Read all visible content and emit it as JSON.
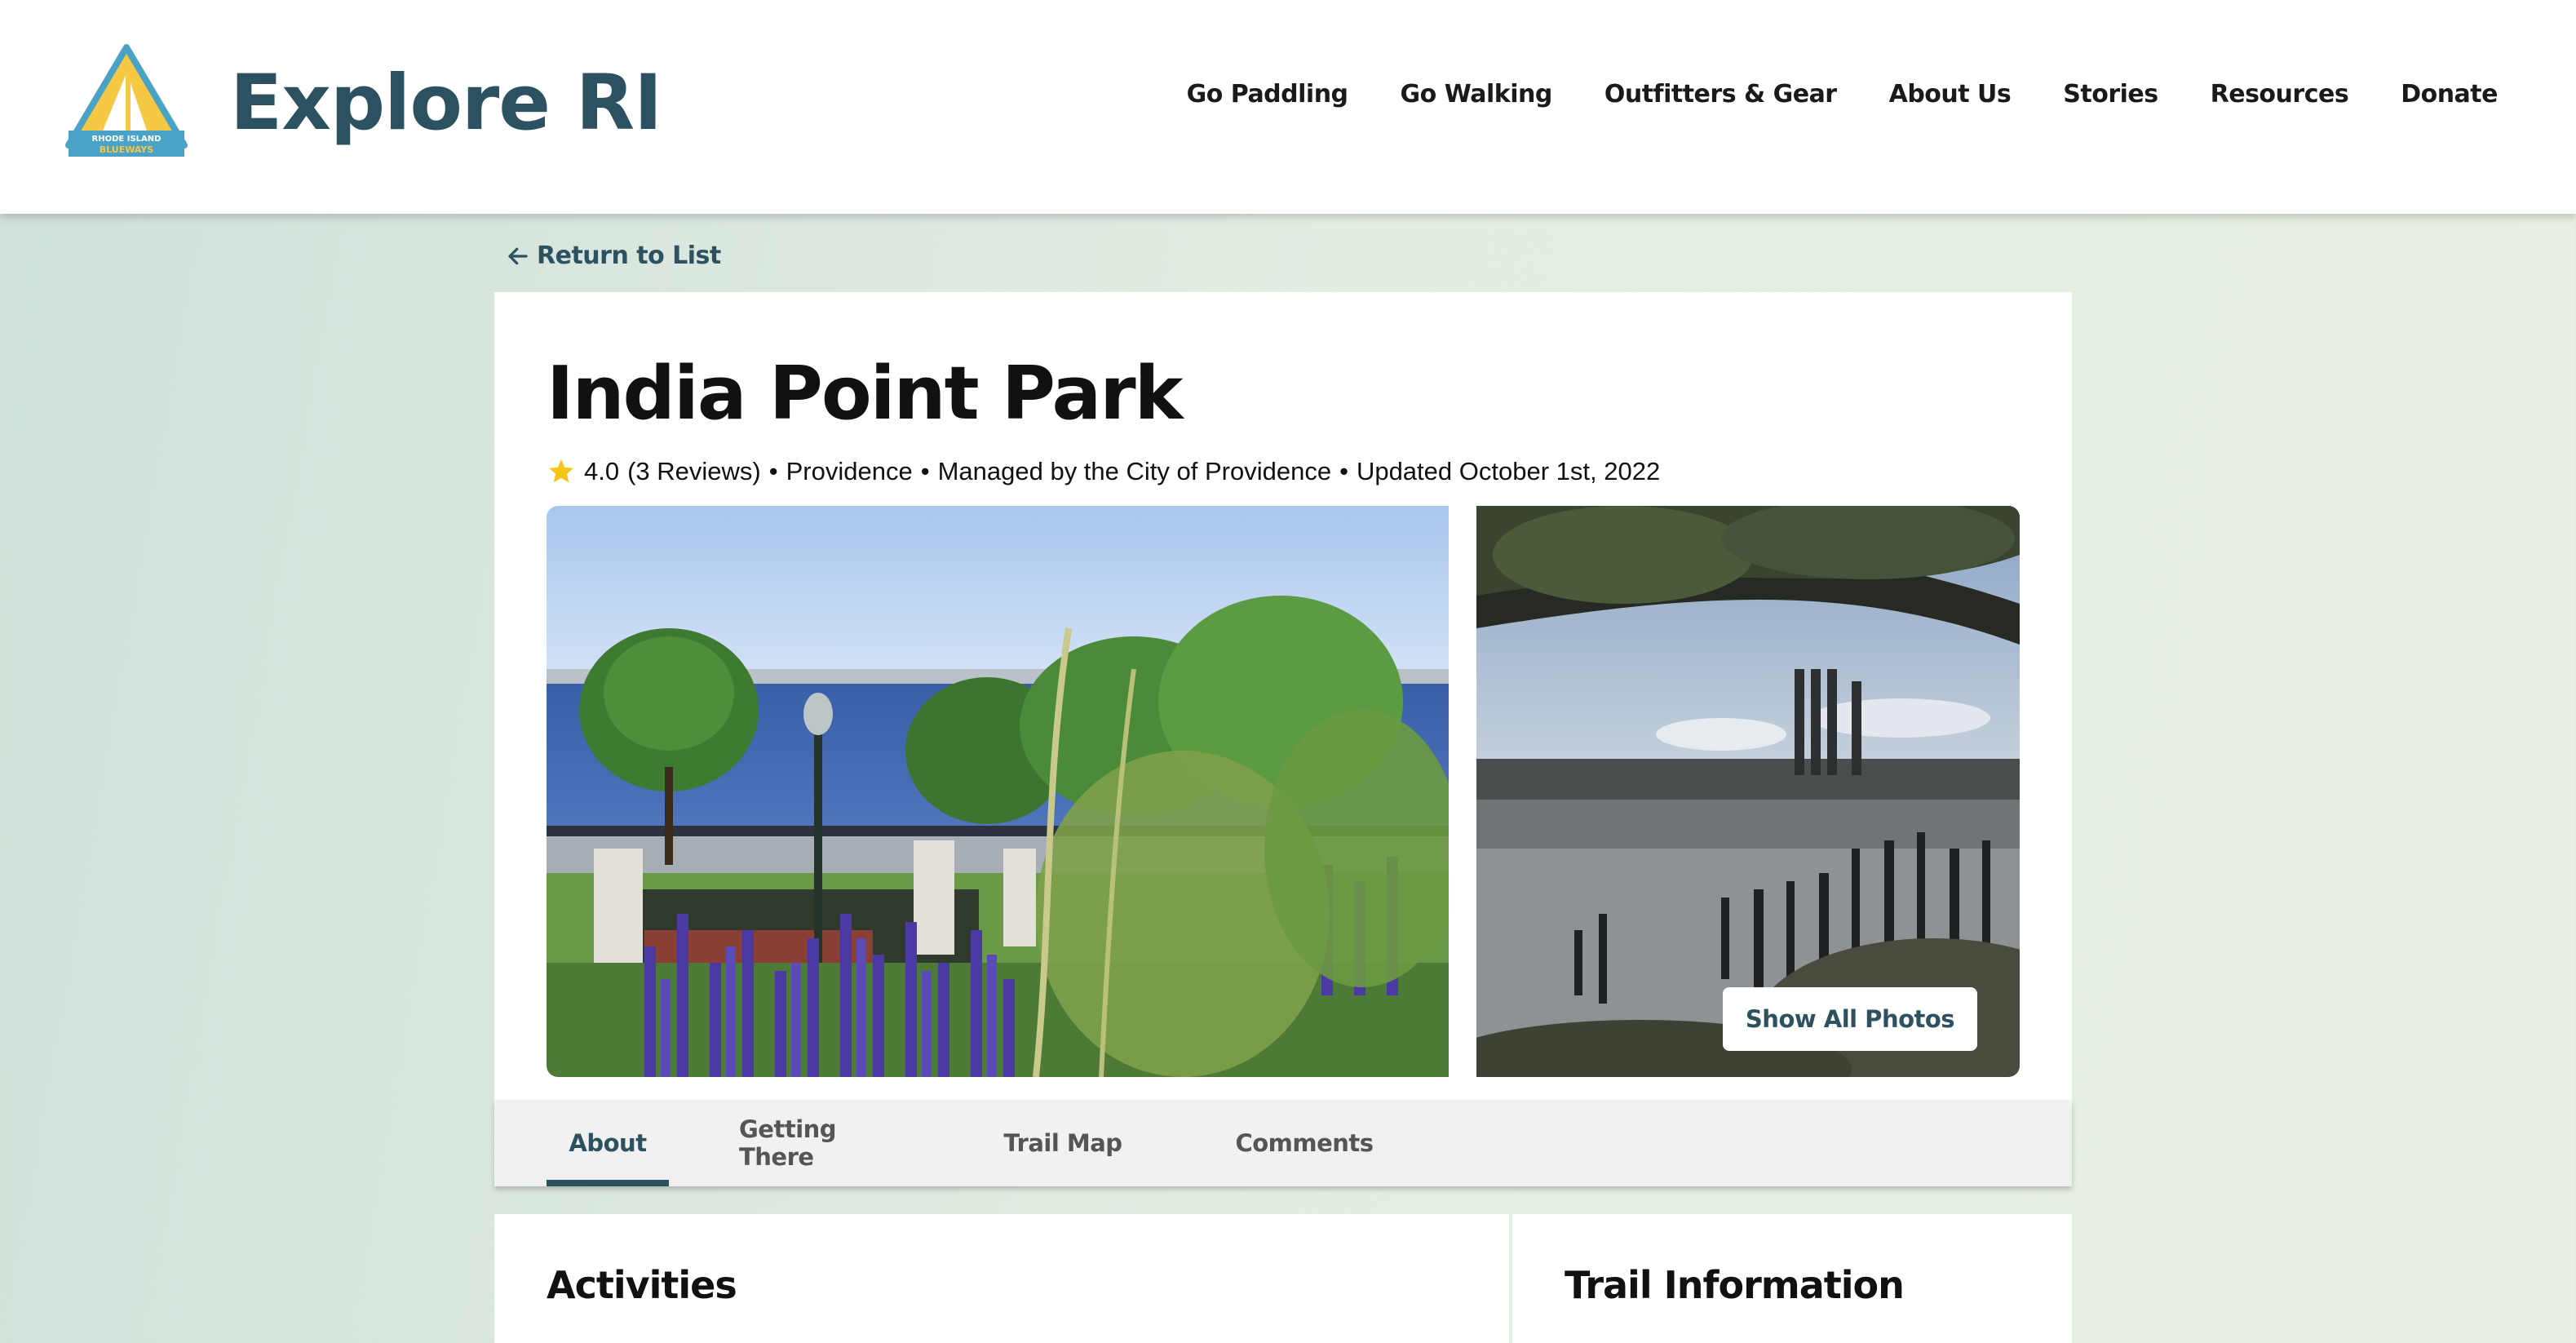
{
  "header": {
    "logo_alt": "Rhode Island Blueways",
    "logo_text_top": "RHODE ISLAND",
    "logo_text_bottom": "BLUEWAYS",
    "brand": "Explore RI",
    "nav": [
      "Go Paddling",
      "Go Walking",
      "Outfitters & Gear",
      "About Us",
      "Stories",
      "Resources",
      "Donate"
    ]
  },
  "back_link": "Return to List",
  "park": {
    "title": "India Point Park",
    "rating": "4.0",
    "reviews": "(3 Reviews)",
    "location": "Providence",
    "managed_by": "Managed by the City of Providence",
    "updated": "Updated October 1st, 2022",
    "separator": "•"
  },
  "photos": {
    "show_all_label": "Show All Photos"
  },
  "tabs": [
    {
      "label": "About",
      "active": true
    },
    {
      "label": "Getting There",
      "active": false
    },
    {
      "label": "Trail Map",
      "active": false
    },
    {
      "label": "Comments",
      "active": false
    }
  ],
  "sections": {
    "activities_title": "Activities",
    "trail_info_title": "Trail Information"
  },
  "colors": {
    "brand": "#2c5160",
    "star": "#f5c518"
  }
}
